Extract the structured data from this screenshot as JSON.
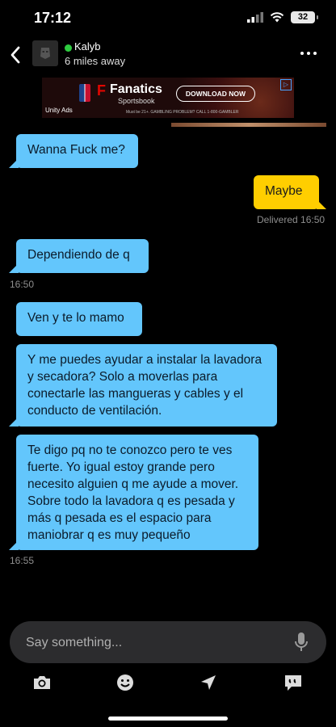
{
  "status": {
    "time": "17:12",
    "battery": "32"
  },
  "header": {
    "name": "Kalyb",
    "distance": "6 miles away"
  },
  "ad": {
    "brand": "Fanatics",
    "sub": "Sportsbook",
    "cta": "DOWNLOAD NOW",
    "network": "Unity Ads",
    "fine_print": "Must be 21+. GAMBLING PROBLEM? CALL 1-800-GAMBLER"
  },
  "messages": [
    {
      "dir": "in",
      "text": "Wanna Fuck me?"
    },
    {
      "dir": "out",
      "text": "Maybe",
      "status": "Delivered 16:50"
    },
    {
      "dir": "in",
      "text": "Dependiendo de q",
      "time": "16:50"
    },
    {
      "dir": "in",
      "text": "Ven y te lo mamo"
    },
    {
      "dir": "in",
      "text": "Y me puedes ayudar a instalar la lavadora y secadora? Solo a moverlas para conectarle las mangueras y cables y el conducto de ventilación."
    },
    {
      "dir": "in",
      "text": "Te digo pq no te conozco pero te ves fuerte. Yo igual estoy grande pero necesito alguien q me ayude a mover. Sobre todo la lavadora q es pesada y más q pesada es el espacio para maniobrar q es muy pequeño",
      "time": "16:55"
    }
  ],
  "composer": {
    "placeholder": "Say something..."
  },
  "toolbar": {
    "icons": [
      "camera-icon",
      "emoji-icon",
      "location-icon",
      "saved-phrases-icon"
    ]
  }
}
